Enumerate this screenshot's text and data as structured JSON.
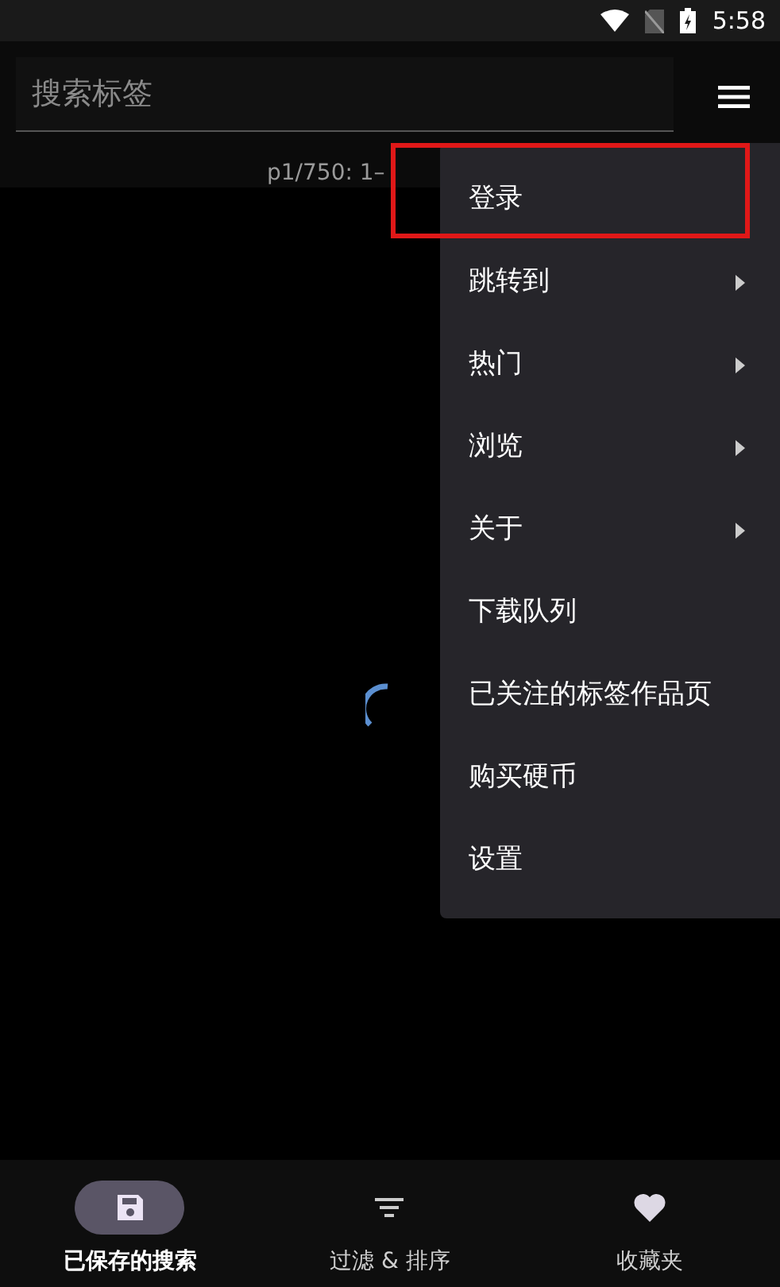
{
  "status_bar": {
    "time": "5:58"
  },
  "search": {
    "placeholder": "搜索标签"
  },
  "page_info": "p1/750: 1–",
  "menu": [
    {
      "label": "登录",
      "has_submenu": false,
      "highlighted": true
    },
    {
      "label": "跳转到",
      "has_submenu": true,
      "highlighted": false
    },
    {
      "label": "热门",
      "has_submenu": true,
      "highlighted": false
    },
    {
      "label": "浏览",
      "has_submenu": true,
      "highlighted": false
    },
    {
      "label": "关于",
      "has_submenu": true,
      "highlighted": false
    },
    {
      "label": "下载队列",
      "has_submenu": false,
      "highlighted": false
    },
    {
      "label": "已关注的标签作品页",
      "has_submenu": false,
      "highlighted": false
    },
    {
      "label": "购买硬币",
      "has_submenu": false,
      "highlighted": false
    },
    {
      "label": "设置",
      "has_submenu": false,
      "highlighted": false
    }
  ],
  "bottom_nav": [
    {
      "label": "已保存的搜索",
      "selected": true
    },
    {
      "label": "过滤 & 排序",
      "selected": false
    },
    {
      "label": "收藏夹",
      "selected": false
    }
  ]
}
